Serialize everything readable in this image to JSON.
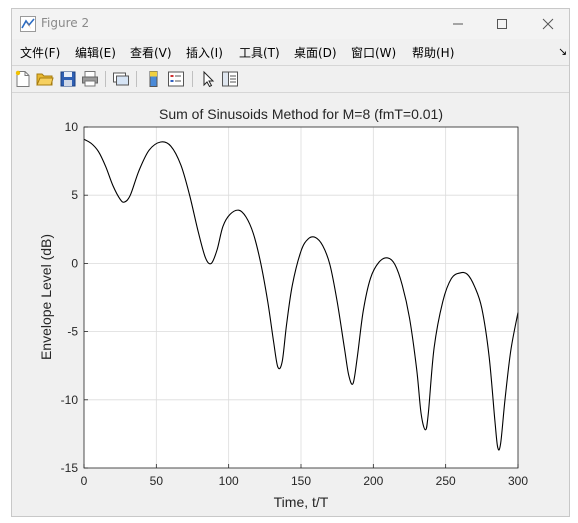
{
  "window": {
    "title": "Figure 2"
  },
  "menus": [
    {
      "label": "文件(F)"
    },
    {
      "label": "编辑(E)"
    },
    {
      "label": "查看(V)"
    },
    {
      "label": "插入(I)"
    },
    {
      "label": "工具(T)"
    },
    {
      "label": "桌面(D)"
    },
    {
      "label": "窗口(W)"
    },
    {
      "label": "帮助(H)"
    }
  ],
  "toolbar_icons": [
    "new-figure-icon",
    "open-folder-icon",
    "save-icon",
    "print-icon",
    "link-plot-icon",
    "colorbar-icon",
    "legend-icon",
    "pointer-icon",
    "property-editor-icon"
  ],
  "chart_data": {
    "type": "line",
    "title": "Sum of Sinusoids Method for M=8 (fmT=0.01)",
    "xlabel": "Time, t/T",
    "ylabel": "Envelope Level (dB)",
    "xlim": [
      0,
      300
    ],
    "ylim": [
      -15,
      10
    ],
    "xticks": [
      0,
      50,
      100,
      150,
      200,
      250,
      300
    ],
    "yticks": [
      -15,
      -10,
      -5,
      0,
      5,
      10
    ],
    "grid": true,
    "series": [
      {
        "color": "#000000",
        "x": [
          0,
          5,
          10,
          15,
          20,
          25,
          28,
          32,
          38,
          45,
          53,
          60,
          67,
          73,
          79,
          84,
          88,
          92,
          96,
          101,
          107,
          112,
          117,
          122,
          127,
          131,
          134,
          137,
          140,
          144,
          150,
          155,
          160,
          165,
          170,
          175,
          180,
          183,
          186,
          189,
          193,
          198,
          204,
          210,
          215,
          220,
          225,
          230,
          233,
          236,
          238,
          242,
          248,
          254,
          260,
          265,
          270,
          275,
          280,
          284,
          286,
          288,
          291,
          295,
          300
        ],
        "values": [
          9.1,
          8.8,
          8.2,
          7.1,
          5.7,
          4.7,
          4.5,
          5.0,
          6.8,
          8.3,
          8.9,
          8.6,
          7.2,
          5.0,
          2.3,
          0.4,
          0.0,
          1.0,
          2.7,
          3.6,
          3.9,
          3.4,
          2.2,
          0.1,
          -2.8,
          -5.7,
          -7.6,
          -7.2,
          -4.5,
          -1.6,
          0.9,
          1.8,
          1.9,
          1.3,
          -0.1,
          -2.8,
          -6.2,
          -8.2,
          -8.8,
          -6.8,
          -3.5,
          -1.1,
          0.1,
          0.4,
          -0.1,
          -1.6,
          -4.0,
          -7.8,
          -11.0,
          -12.2,
          -11.0,
          -6.2,
          -2.8,
          -1.1,
          -0.7,
          -0.8,
          -1.7,
          -3.3,
          -6.8,
          -11.5,
          -13.5,
          -13.2,
          -10.0,
          -6.4,
          -3.6
        ]
      }
    ]
  }
}
